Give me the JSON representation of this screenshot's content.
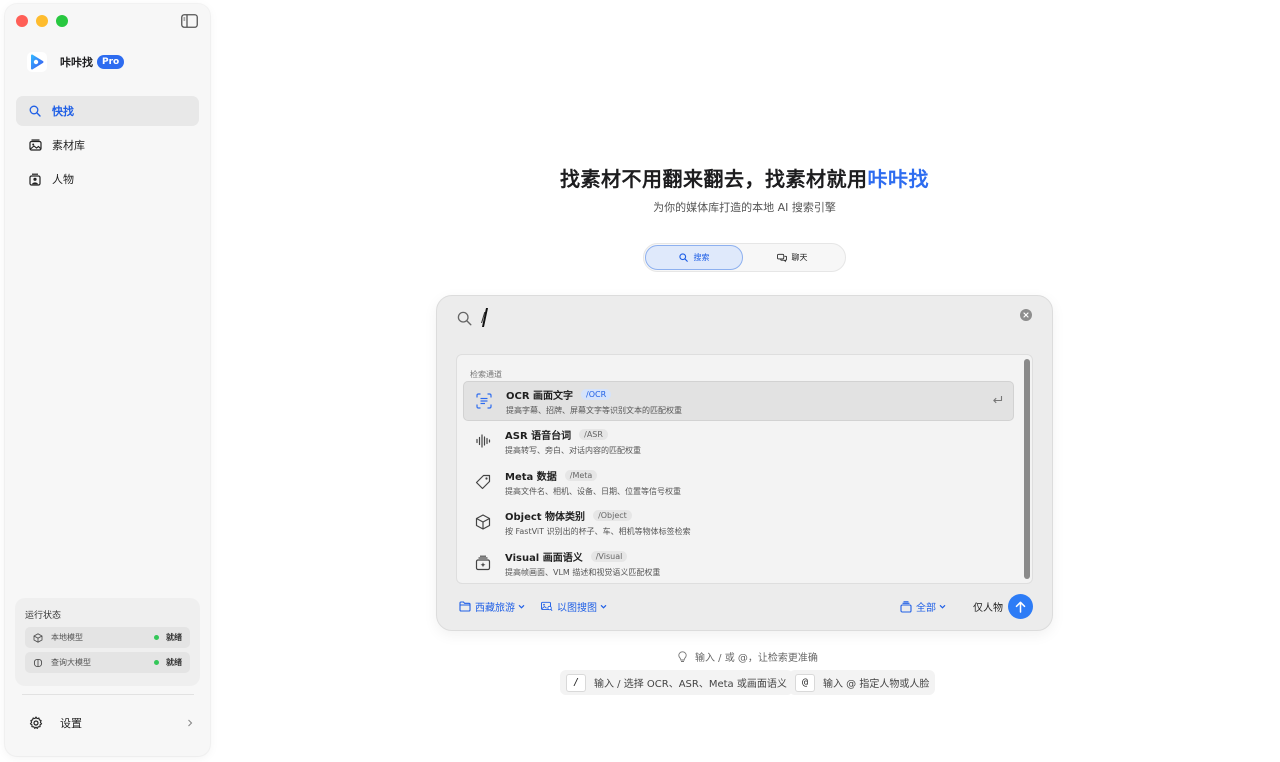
{
  "app": {
    "name": "咔咔找",
    "badge": "Pro",
    "accent_color": "#2d6cf0"
  },
  "sidebar": {
    "nav": [
      {
        "label": "快找",
        "icon": "search-icon",
        "active": true
      },
      {
        "label": "素材库",
        "icon": "media-library-icon",
        "active": false
      },
      {
        "label": "人物",
        "icon": "people-icon",
        "active": false
      }
    ],
    "status": {
      "title": "运行状态",
      "items": [
        {
          "label": "本地模型",
          "icon": "cube-icon",
          "value": "就绪",
          "color": "#34c759"
        },
        {
          "label": "查询大模型",
          "icon": "brain-icon",
          "value": "就绪",
          "color": "#34c759"
        }
      ]
    },
    "settings_label": "设置"
  },
  "hero": {
    "title_main": "找素材不用翻来翻去，找素材就用",
    "title_accent": "咔咔找",
    "subtitle": "为你的媒体库打造的本地 AI 搜索引擎"
  },
  "mode": {
    "search_label": "搜索",
    "chat_label": "聊天"
  },
  "search": {
    "query": "/",
    "placeholder": ""
  },
  "channels": {
    "heading": "检索通道",
    "items": [
      {
        "name": "OCR 画面文字",
        "tag": "/OCR",
        "desc": "提高字幕、招牌、屏幕文字等识别文本的匹配权重",
        "icon": "text-scan-icon",
        "selected": true
      },
      {
        "name": "ASR 语音台词",
        "tag": "/ASR",
        "desc": "提高转写、旁白、对话内容的匹配权重",
        "icon": "waveform-icon",
        "selected": false
      },
      {
        "name": "Meta 数据",
        "tag": "/Meta",
        "desc": "提高文件名、相机、设备、日期、位置等信号权重",
        "icon": "tag-icon",
        "selected": false
      },
      {
        "name": "Object 物体类别",
        "tag": "/Object",
        "desc": "按 FastViT 识别出的杯子、车、相机等物体标签检索",
        "icon": "cube-icon",
        "selected": false
      },
      {
        "name": "Visual 画面语义",
        "tag": "/Visual",
        "desc": "提高帧画面、VLM 描述和视觉语义匹配权重",
        "icon": "visual-stack-icon",
        "selected": false
      }
    ]
  },
  "footer": {
    "folder_label": "西藏旅游",
    "image_search_label": "以图搜图",
    "scope_label": "全部",
    "people_only_label": "仅人物"
  },
  "hints": {
    "main": "输入 / 或 @，让检索更准确",
    "slash_key": "/",
    "slash_text": "输入 / 选择 OCR、ASR、Meta 或画面语义",
    "at_key": "@",
    "at_text": "输入 @ 指定人物或人脸"
  }
}
